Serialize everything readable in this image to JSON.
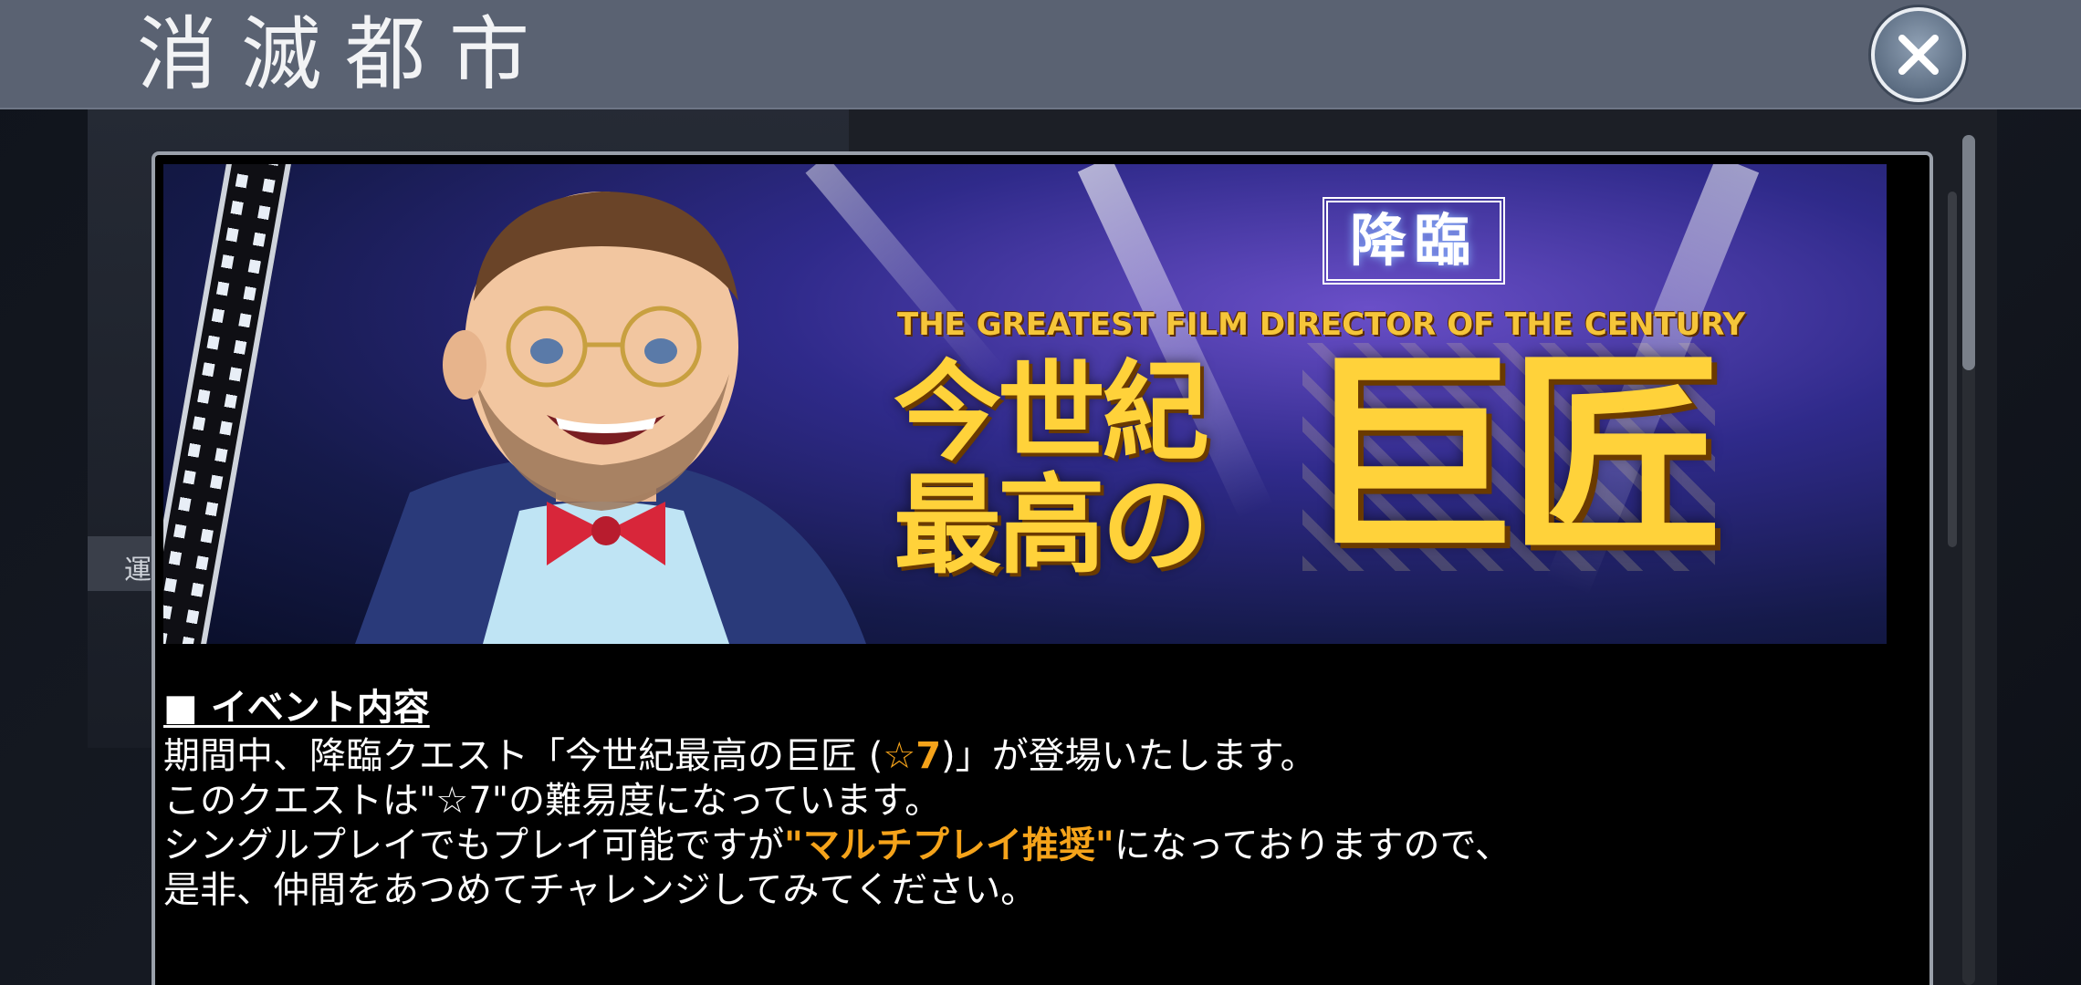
{
  "header": {
    "title": "消滅都市"
  },
  "background": {
    "side_label": "運"
  },
  "banner": {
    "kourin_label": "降臨",
    "subtitle": "THE GREATEST FILM DIRECTOR OF THE CENTURY",
    "title_part1_line1": "今世紀",
    "title_part1_line2": "最高の",
    "title_part2": "巨匠"
  },
  "content": {
    "section_heading": "■ イベント内容",
    "line1_a": "期間中、降臨クエスト「今世紀最高の巨匠 (",
    "line1_star": "☆7",
    "line1_b": ")」が登場いたします。",
    "line2": "このクエストは\"☆7\"の難易度になっています。",
    "line3_a": "シングルプレイでもプレイ可能ですが",
    "line3_highlight": "\"マルチプレイ推奨\"",
    "line3_b": "になっておりますので、",
    "line4": "是非、仲間をあつめてチャレンジしてみてください。"
  },
  "colors": {
    "header_bg": "#5a6272",
    "highlight": "#f5a31a",
    "title_gold": "#ffd23a"
  },
  "icons": {
    "close": "close-icon"
  }
}
